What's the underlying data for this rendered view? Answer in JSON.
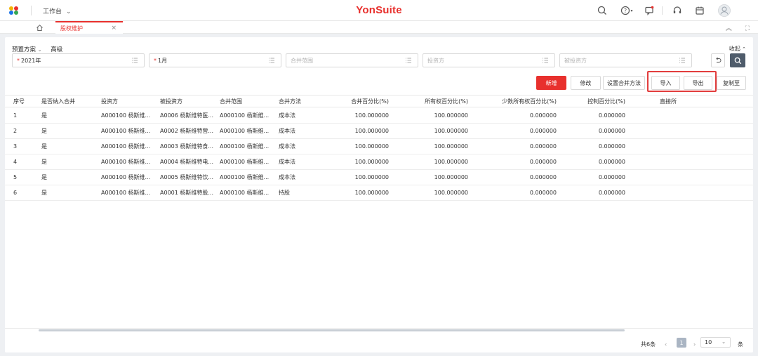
{
  "topbar": {
    "workbench_label": "工作台",
    "brand_yon": "Yon",
    "brand_suite": "Suite"
  },
  "tabs": {
    "active_label": "股权维护"
  },
  "query": {
    "scheme_label": "预置方案",
    "advanced_label": "高级",
    "collapse_label": "收起",
    "year_value": "2021年",
    "month_value": "1月",
    "scope_placeholder": "合并范围",
    "investor_placeholder": "投资方",
    "investee_placeholder": "被投资方"
  },
  "toolbar": {
    "add_label": "新增",
    "edit_label": "修改",
    "set_method_label": "设置合并方法",
    "import_label": "导入",
    "export_label": "导出",
    "copy_label": "复制至"
  },
  "table": {
    "headers": [
      "序号",
      "是否纳入合并",
      "投资方",
      "被投资方",
      "合并范围",
      "合并方法",
      "合并百分比(%)",
      "所有权百分比(%)",
      "少数所有权百分比(%)",
      "控制百分比(%)",
      "直接所"
    ],
    "rows": [
      [
        "1",
        "是",
        "A000100 杨斯维...",
        "A0006 杨斯维特医...",
        "A000100 杨斯维...",
        "成本法",
        "100.000000",
        "100.000000",
        "0.000000",
        "0.000000"
      ],
      [
        "2",
        "是",
        "A000100 杨斯维...",
        "A0002 杨斯维特营...",
        "A000100 杨斯维...",
        "成本法",
        "100.000000",
        "100.000000",
        "0.000000",
        "0.000000"
      ],
      [
        "3",
        "是",
        "A000100 杨斯维...",
        "A0003 杨斯维特食...",
        "A000100 杨斯维...",
        "成本法",
        "100.000000",
        "100.000000",
        "0.000000",
        "0.000000"
      ],
      [
        "4",
        "是",
        "A000100 杨斯维...",
        "A0004 杨斯维特电...",
        "A000100 杨斯维...",
        "成本法",
        "100.000000",
        "100.000000",
        "0.000000",
        "0.000000"
      ],
      [
        "5",
        "是",
        "A000100 杨斯维...",
        "A0005 杨斯维特饮...",
        "A000100 杨斯维...",
        "成本法",
        "100.000000",
        "100.000000",
        "0.000000",
        "0.000000"
      ],
      [
        "6",
        "是",
        "A000100 杨斯维...",
        "A0001 杨斯维特股...",
        "A000100 杨斯维...",
        "持股",
        "100.000000",
        "100.000000",
        "0.000000",
        "0.000000"
      ]
    ]
  },
  "pagination": {
    "total_label": "共6条",
    "prev": "‹",
    "current_page": "1",
    "next": "›",
    "page_size": "10",
    "unit_label": "条"
  },
  "colors": {
    "accent": "#e8302d",
    "highlight_box": "#e23d3d",
    "search_button": "#4f5c6b"
  }
}
